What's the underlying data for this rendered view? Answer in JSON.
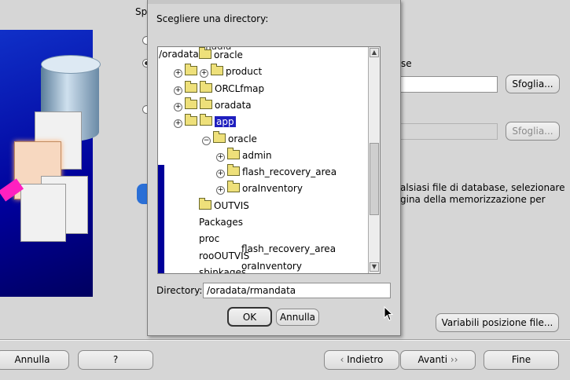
{
  "wizard": {
    "top_label_partial": "Sp",
    "right_label_partial": "se",
    "browse1": "Sfoglia...",
    "browse2": "Sfoglia...",
    "info_line1": "alsiasi file di database, selezionare",
    "info_line2": "gina della memorizzazione per",
    "file_locations_button": "Variabili posizione file...",
    "footer": {
      "cancel": "Annulla",
      "help": "?",
      "back": "Indietro",
      "next": "Avanti",
      "finish": "Fine"
    }
  },
  "dialog": {
    "prompt": "Scegliere una directory:",
    "tree_header_path": "/oradata",
    "tree_overlap_text": "madia",
    "tree": [
      {
        "label": "oracle",
        "indent": 0,
        "expander": "",
        "folder": true
      },
      {
        "label": "product",
        "indent": 1,
        "expander": "+",
        "folder": true
      },
      {
        "label": "ORCLfmap",
        "indent": 1,
        "expander": "+",
        "folder": true
      },
      {
        "label": "oradata",
        "indent": 1,
        "expander": "+",
        "folder": true
      },
      {
        "label": "app",
        "indent": 1,
        "expander": "+",
        "folder": true,
        "selected": true
      },
      {
        "label": "oracle",
        "indent": 2,
        "expander": "−",
        "folder": true
      },
      {
        "label": "admin",
        "indent": 3,
        "expander": "+",
        "folder": true
      },
      {
        "label": "flash_recovery_area",
        "indent": 3,
        "expander": "+",
        "folder": true
      },
      {
        "label": "oraInventory",
        "indent": 3,
        "expander": "+",
        "folder": true
      },
      {
        "label": "OUTVIS",
        "indent": 1,
        "expander": "",
        "folder": true
      },
      {
        "label": "Packages",
        "indent": 1,
        "expander": "",
        "folder": false
      },
      {
        "label": "proc",
        "indent": 1,
        "expander": "",
        "folder": false
      },
      {
        "label": "rooOUTVIS",
        "indent": 1,
        "expander": "",
        "folder": false
      },
      {
        "label": "sbinkages",
        "indent": 1,
        "expander": "",
        "folder": false
      }
    ],
    "ghost_rows": [
      "flash_recovery_area",
      "oraInventory"
    ],
    "directory_label": "Directory:",
    "directory_value": "/oradata/rmandata",
    "ok": "OK",
    "cancel": "Annulla"
  }
}
